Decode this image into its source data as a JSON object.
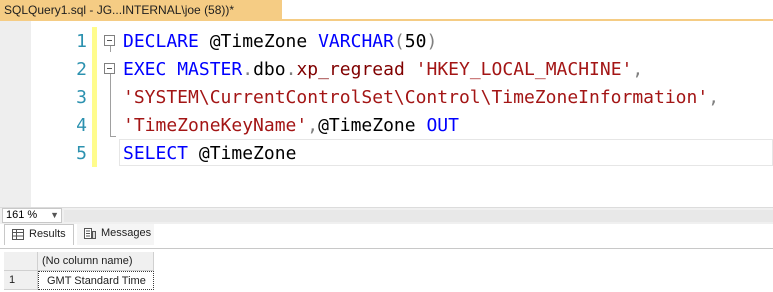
{
  "tab": {
    "title": "SQLQuery1.sql - JG...INTERNAL\\joe (58))*",
    "close_glyph": "×"
  },
  "editor": {
    "line_numbers": [
      "1",
      "2",
      "3",
      "4",
      "5"
    ],
    "lines": [
      [
        {
          "t": "DECLARE",
          "c": "kw"
        },
        {
          "t": " "
        },
        {
          "t": "@TimeZone",
          "c": "var"
        },
        {
          "t": " "
        },
        {
          "t": "VARCHAR",
          "c": "kw"
        },
        {
          "t": "(",
          "c": "op"
        },
        {
          "t": "50",
          "c": "var"
        },
        {
          "t": ")",
          "c": "op"
        }
      ],
      [
        {
          "t": "EXEC",
          "c": "kw"
        },
        {
          "t": " "
        },
        {
          "t": "MASTER",
          "c": "kw"
        },
        {
          "t": ".",
          "c": "op"
        },
        {
          "t": "dbo",
          "c": "var"
        },
        {
          "t": ".",
          "c": "op"
        },
        {
          "t": "xp_regread",
          "c": "fn"
        },
        {
          "t": " "
        },
        {
          "t": "'HKEY_LOCAL_MACHINE'",
          "c": "str"
        },
        {
          "t": ",",
          "c": "op"
        }
      ],
      [
        {
          "t": "'SYSTEM\\CurrentControlSet\\Control\\TimeZoneInformation'",
          "c": "str"
        },
        {
          "t": ",",
          "c": "op"
        }
      ],
      [
        {
          "t": "'TimeZoneKeyName'",
          "c": "str"
        },
        {
          "t": ",",
          "c": "op"
        },
        {
          "t": "@TimeZone",
          "c": "var"
        },
        {
          "t": " "
        },
        {
          "t": "OUT",
          "c": "kw"
        }
      ],
      [
        {
          "t": "SELECT",
          "c": "kw"
        },
        {
          "t": " "
        },
        {
          "t": "@TimeZone",
          "c": "var"
        }
      ]
    ]
  },
  "statusbar": {
    "zoom": "161 %",
    "zoom_dropdown_glyph": "▼"
  },
  "results": {
    "tabs": [
      {
        "label": "Results",
        "icon": "grid-icon",
        "active": true
      },
      {
        "label": "Messages",
        "icon": "messages-icon",
        "active": false
      }
    ],
    "columns": [
      "(No column name)"
    ],
    "rows": [
      {
        "num": "1",
        "values": [
          "GMT Standard Time"
        ]
      }
    ]
  },
  "colors": {
    "tab_accent": "#f5cc84",
    "keyword": "#0000ff",
    "string": "#a31515",
    "function": "#800000",
    "line_number": "#2b91af",
    "change_marker": "#fffc8c"
  }
}
